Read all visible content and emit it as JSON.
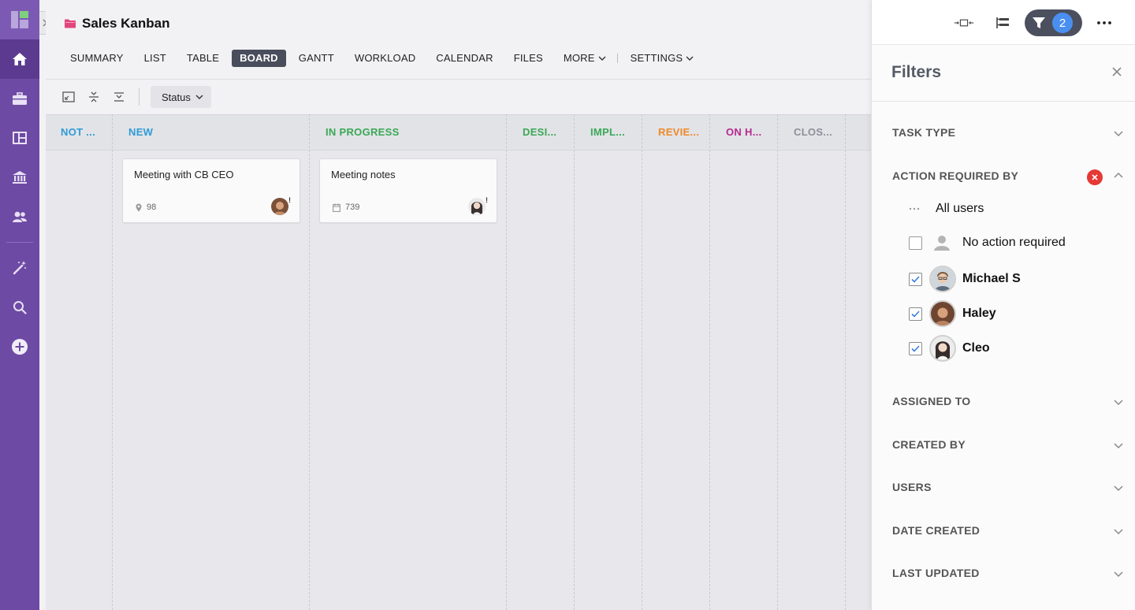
{
  "project": {
    "title": "Sales Kanban",
    "folder_icon": "folder-icon",
    "folder_color": "#e0457b"
  },
  "rail": {
    "bg": "#6d4aa4",
    "items": [
      {
        "name": "home",
        "icon": "home-icon"
      },
      {
        "name": "portfolio",
        "icon": "briefcase-icon"
      },
      {
        "name": "dashboards",
        "icon": "dashboard-icon"
      },
      {
        "name": "workspace",
        "icon": "bank-icon"
      },
      {
        "name": "users",
        "icon": "people-icon"
      },
      {
        "name": "automation",
        "icon": "magic-wand-icon"
      },
      {
        "name": "search",
        "icon": "search-icon"
      },
      {
        "name": "create",
        "icon": "plus-circle-icon"
      }
    ]
  },
  "tabs": [
    {
      "label": "SUMMARY"
    },
    {
      "label": "LIST"
    },
    {
      "label": "TABLE"
    },
    {
      "label": "BOARD",
      "active": true
    },
    {
      "label": "GANTT"
    },
    {
      "label": "WORKLOAD"
    },
    {
      "label": "CALENDAR"
    },
    {
      "label": "FILES"
    },
    {
      "label": "MORE"
    },
    {
      "label": "SETTINGS"
    }
  ],
  "toolbar": {
    "group_by": "Status"
  },
  "columns": [
    {
      "label": "NOT ...",
      "color": "#2f9bd6"
    },
    {
      "label": "NEW",
      "color": "#2f9bd6"
    },
    {
      "label": "IN PROGRESS",
      "color": "#3aa856"
    },
    {
      "label": "DESI...",
      "color": "#3aa856"
    },
    {
      "label": "IMPL...",
      "color": "#3aa856"
    },
    {
      "label": "REVIE...",
      "color": "#ef8a2b"
    },
    {
      "label": "ON H...",
      "color": "#b5298f"
    },
    {
      "label": "CLOS...",
      "color": "#8d8f99"
    }
  ],
  "cards": [
    {
      "title": "Meeting with CB CEO",
      "meta_icon": "pin-icon",
      "meta": "98",
      "assignee": "Haley"
    },
    {
      "title": "Meeting notes",
      "meta_icon": "calendar-icon",
      "meta": "739",
      "assignee": "Cleo"
    }
  ],
  "filters": {
    "title": "Filters",
    "active_count": "2",
    "sections": {
      "task_type": "TASK TYPE",
      "action_required_by": "ACTION REQUIRED BY",
      "assigned_to": "ASSIGNED TO",
      "created_by": "CREATED BY",
      "users": "USERS",
      "date_created": "DATE CREATED",
      "last_updated": "LAST UPDATED"
    },
    "options": {
      "all_users": "All users",
      "no_action": "No action required",
      "users": [
        {
          "name": "Michael S",
          "checked": true
        },
        {
          "name": "Haley",
          "checked": true
        },
        {
          "name": "Cleo",
          "checked": true
        }
      ]
    }
  }
}
